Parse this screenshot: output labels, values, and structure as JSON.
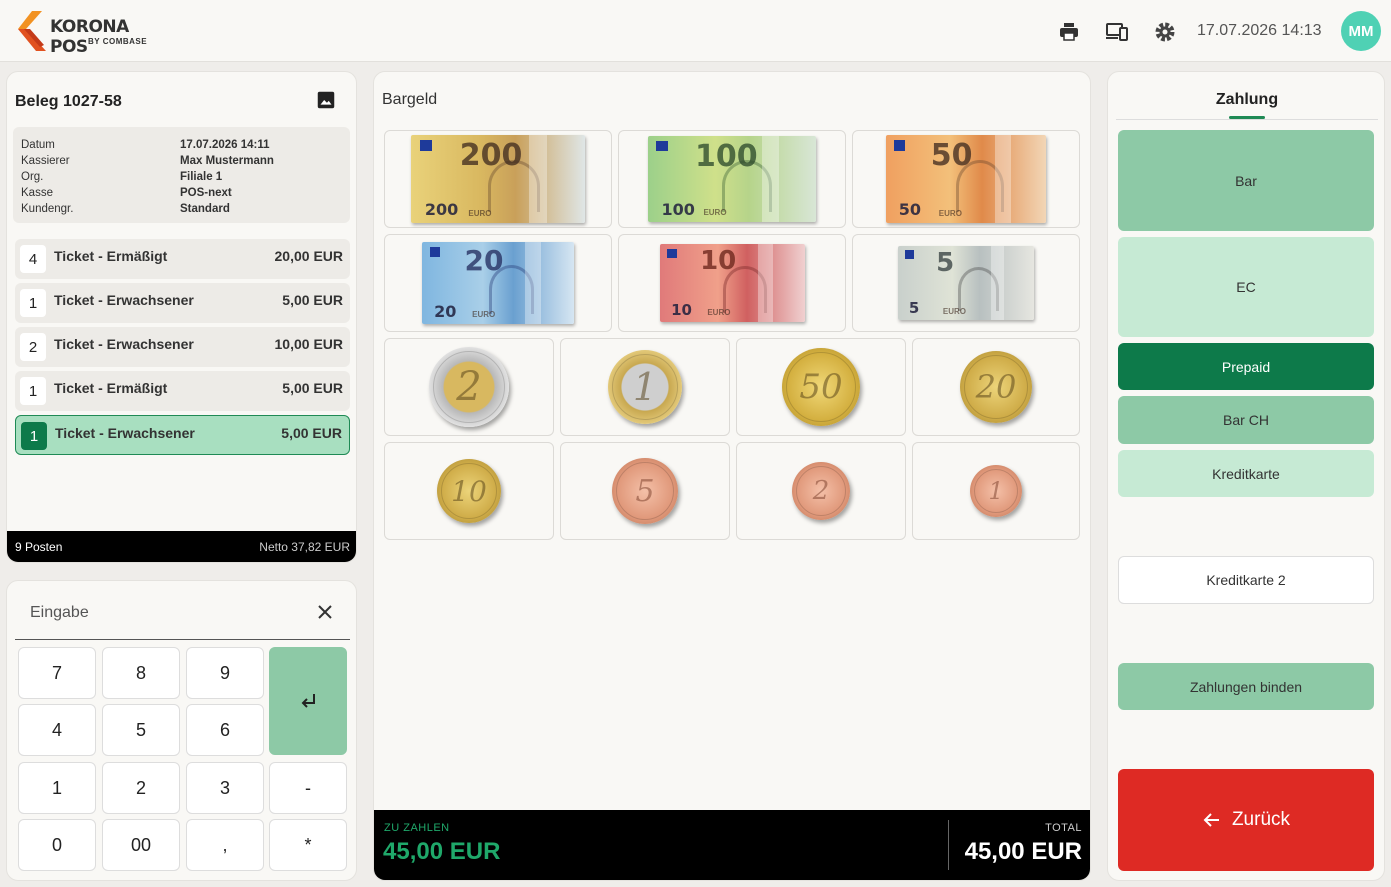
{
  "app": {
    "name": "KORONA POS",
    "sub": "BY COMBASE",
    "datetime": "17.07.2026 14:13",
    "user_initials": "MM"
  },
  "receipt": {
    "title": "Beleg 1027-58",
    "info": [
      {
        "k": "Datum",
        "v": "17.07.2026 14:11"
      },
      {
        "k": "Kassierer",
        "v": "Max Mustermann"
      },
      {
        "k": "Org.",
        "v": "Filiale 1"
      },
      {
        "k": "Kasse",
        "v": "POS-next"
      },
      {
        "k": "Kundengr.",
        "v": "Standard"
      }
    ],
    "items": [
      {
        "qty": "4",
        "name": "Ticket - Ermäßigt",
        "price": "20,00 EUR"
      },
      {
        "qty": "1",
        "name": "Ticket - Erwachsener",
        "price": "5,00 EUR"
      },
      {
        "qty": "2",
        "name": "Ticket - Erwachsener",
        "price": "10,00 EUR"
      },
      {
        "qty": "1",
        "name": "Ticket - Ermäßigt",
        "price": "5,00 EUR"
      },
      {
        "qty": "1",
        "name": "Ticket - Erwachsener",
        "price": "5,00 EUR"
      }
    ],
    "footer_left": "9 Posten",
    "footer_right": "Netto 37,82 EUR"
  },
  "keypad": {
    "label": "Eingabe",
    "keys": [
      "7",
      "8",
      "9",
      "4",
      "5",
      "6",
      "1",
      "2",
      "3",
      "-",
      "0",
      "00",
      ",",
      "*"
    ]
  },
  "cash": {
    "title": "Bargeld",
    "notes": [
      "200",
      "100",
      "50",
      "20",
      "10",
      "5"
    ],
    "coins": [
      "2",
      "1",
      "50",
      "20",
      "10",
      "5",
      "2",
      "1"
    ],
    "due_label": "ZU ZAHLEN",
    "due_value": "45,00 EUR",
    "total_label": "TOTAL",
    "total_value": "45,00 EUR"
  },
  "payment": {
    "tab": "Zahlung",
    "methods": [
      "Bar",
      "EC",
      "Prepaid",
      "Bar CH",
      "Kreditkarte",
      "Kreditkarte 2",
      "Zahlungen binden"
    ],
    "back": "Zurück"
  },
  "colors": {
    "accent": "#1f8a55",
    "prepaid": "#0d7a4a",
    "back": "#de2a24",
    "avatar": "#4fd1b4"
  }
}
